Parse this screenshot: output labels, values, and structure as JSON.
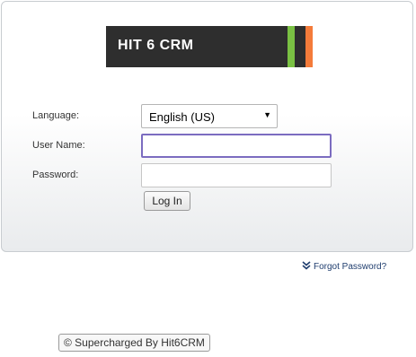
{
  "logo": {
    "text": "HIT 6 CRM",
    "accent_green": "#7ac143",
    "accent_orange": "#f47b3a"
  },
  "form": {
    "language_label": "Language:",
    "language_value": "English (US)",
    "username_label": "User Name:",
    "username_value": "",
    "password_label": "Password:",
    "password_value": "",
    "login_label": "Log In"
  },
  "links": {
    "forgot_password": "Forgot Password?"
  },
  "footer": {
    "powered_by": "© Supercharged By Hit6CRM"
  }
}
